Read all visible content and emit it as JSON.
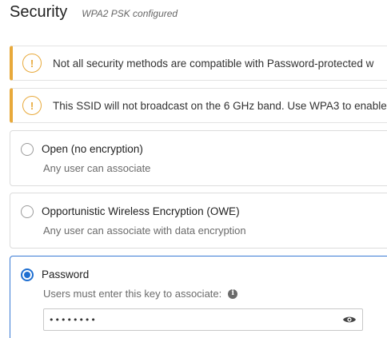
{
  "header": {
    "title": "Security",
    "subtitle": "WPA2 PSK configured"
  },
  "banners": [
    {
      "icon": "warning-icon",
      "icon_glyph": "!",
      "text": "Not all security methods are compatible with Password-protected w"
    },
    {
      "icon": "warning-icon",
      "icon_glyph": "!",
      "text": "This SSID will not broadcast on the 6 GHz band. Use WPA3 to enable"
    }
  ],
  "options": [
    {
      "label": "Open (no encryption)",
      "description": "Any user can associate",
      "selected": false
    },
    {
      "label": "Opportunistic Wireless Encryption (OWE)",
      "description": "Any user can associate with data encryption",
      "selected": false
    },
    {
      "label": "Password",
      "description": "Users must enter this key to associate:",
      "selected": true,
      "info_icon": "info-icon",
      "info_glyph": "i",
      "password_value": "••••••••",
      "reveal_icon": "eye-icon"
    }
  ],
  "colors": {
    "warning": "#e8a93a",
    "selected": "#1f6fd1",
    "selected_border": "#3a7bd5"
  }
}
